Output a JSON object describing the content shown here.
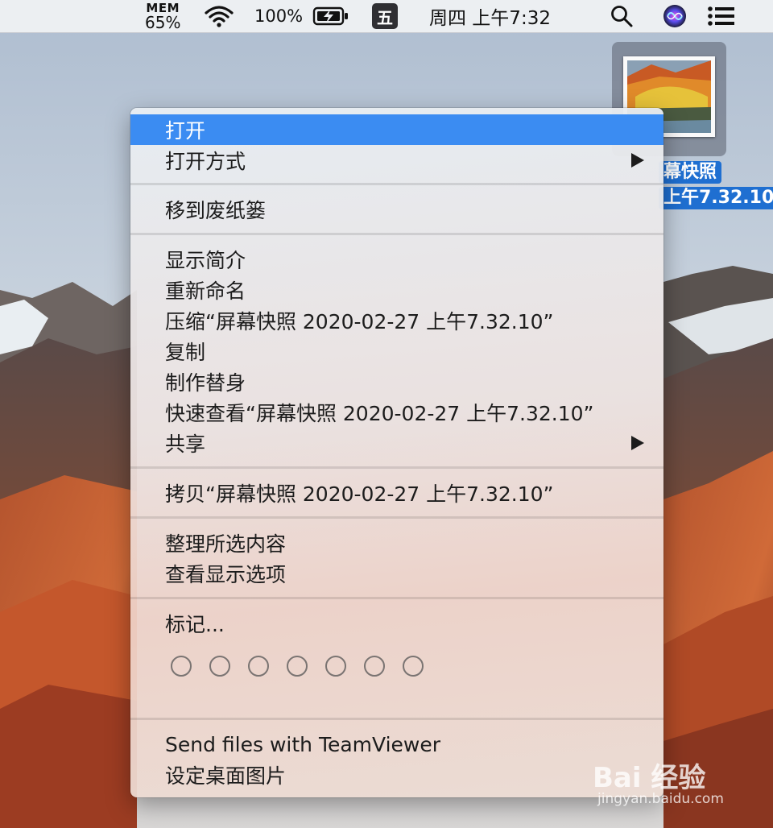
{
  "menubar": {
    "mem_label": "MEM",
    "mem_value": "65%",
    "battery_percent": "100%",
    "input_method": "五",
    "clock": "周四 上午7:32",
    "icons": [
      "wifi-icon",
      "battery-charging-icon",
      "search-icon",
      "siri-icon",
      "list-icon"
    ]
  },
  "desktop_file": {
    "name_line1": "幕快照",
    "name_line2": "上午7.32.10"
  },
  "context_menu": {
    "open": "打开",
    "open_with": "打开方式",
    "move_to_trash": "移到废纸篓",
    "get_info": "显示简介",
    "rename": "重新命名",
    "compress": "压缩“屏幕快照 2020-02-27 上午7.32.10”",
    "duplicate": "复制",
    "make_alias": "制作替身",
    "quick_look": "快速查看“屏幕快照 2020-02-27 上午7.32.10”",
    "share": "共享",
    "copy": "拷贝“屏幕快照 2020-02-27 上午7.32.10”",
    "clean_up_selection": "整理所选内容",
    "show_view_options": "查看显示选项",
    "tags": "标记...",
    "tag_colors": [
      "#ffffff",
      "#ffffff",
      "#ffffff",
      "#ffffff",
      "#ffffff",
      "#ffffff",
      "#ffffff"
    ],
    "teamviewer": "Send files with TeamViewer",
    "set_desktop_picture": "设定桌面图片"
  },
  "colors": {
    "highlight": "#3b8cf2",
    "selection_label": "#1f6fd1"
  },
  "watermark": {
    "main": "Bai 经验",
    "sub": "jingyan.baidu.com"
  }
}
